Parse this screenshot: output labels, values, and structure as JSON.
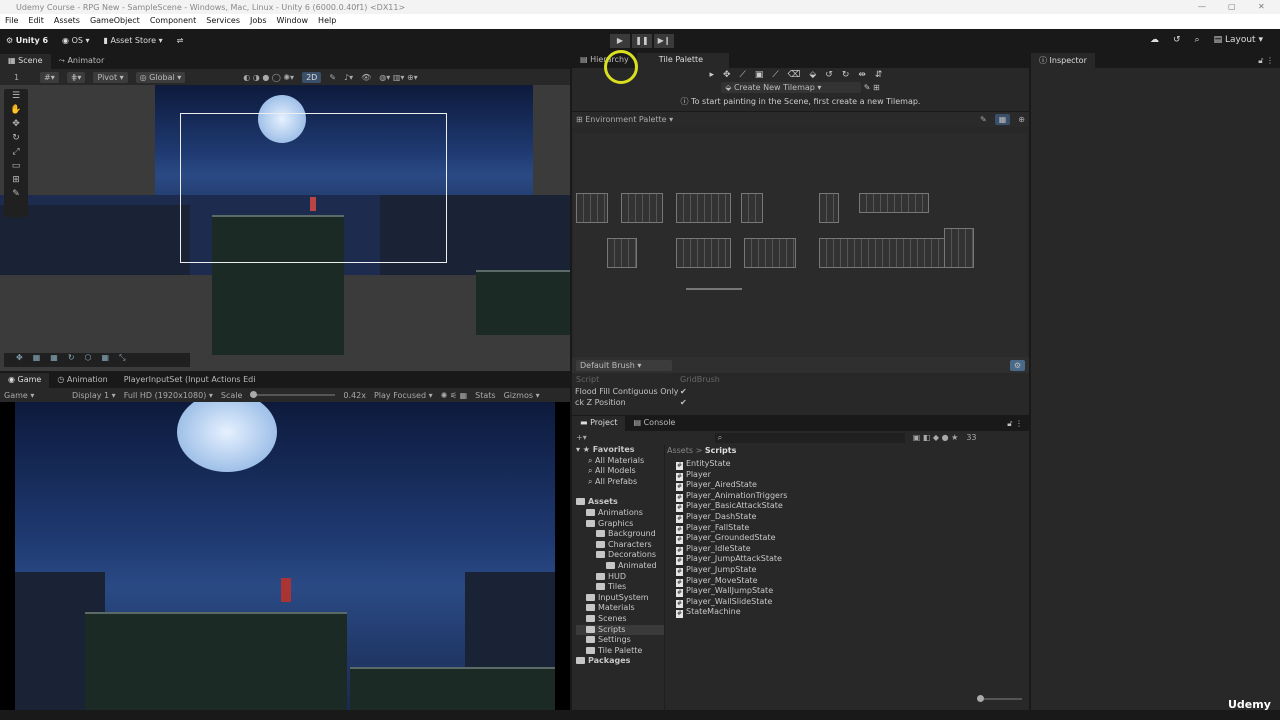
{
  "window": {
    "title": "Udemy Course - RPG New - SampleScene - Windows, Mac, Linux - Unity 6 (6000.0.40f1) <DX11>"
  },
  "menu": [
    "File",
    "Edit",
    "Assets",
    "GameObject",
    "Component",
    "Services",
    "Jobs",
    "Window",
    "Help"
  ],
  "toolbar": {
    "unity": "Unity 6",
    "account": "OS",
    "asset_store": "Asset Store",
    "layout": "Layout"
  },
  "scene": {
    "tabs": [
      "Scene",
      "Animator"
    ],
    "layer": "1",
    "pivot": "Pivot",
    "global": "Global",
    "mode2d": "2D"
  },
  "game": {
    "tabs": [
      "Game",
      "Animation",
      "PlayerInputSet (Input Actions Edi"
    ],
    "view": "Game",
    "display": "Display 1",
    "resolution": "Full HD (1920x1080)",
    "scale_label": "Scale",
    "scale_value": "0.42x",
    "play_mode": "Play Focused",
    "stats": "Stats",
    "gizmos": "Gizmos"
  },
  "tilepalette": {
    "tabs": [
      "Hierarchy",
      "Tile Palette"
    ],
    "target": "Create New Tilemap",
    "info": "To start painting in the Scene, first create a new Tilemap.",
    "palette": "Environment Palette",
    "brush": "Default Brush",
    "script_label": "Script",
    "script_value": "GridBrush",
    "flood_fill": "Flood Fill Contiguous Only",
    "lock_z": "ck Z Position"
  },
  "project": {
    "tabs": [
      "Project",
      "Console"
    ],
    "count": "33",
    "breadcrumb": [
      "Assets",
      "Scripts"
    ],
    "favorites": {
      "label": "Favorites",
      "items": [
        "All Materials",
        "All Models",
        "All Prefabs"
      ]
    },
    "tree": [
      {
        "label": "Assets",
        "level": 0
      },
      {
        "label": "Animations",
        "level": 1
      },
      {
        "label": "Graphics",
        "level": 1
      },
      {
        "label": "Background",
        "level": 2
      },
      {
        "label": "Characters",
        "level": 2
      },
      {
        "label": "Decorations",
        "level": 2
      },
      {
        "label": "Animated",
        "level": 3
      },
      {
        "label": "HUD",
        "level": 2
      },
      {
        "label": "Tiles",
        "level": 2
      },
      {
        "label": "InputSystem",
        "level": 1
      },
      {
        "label": "Materials",
        "level": 1
      },
      {
        "label": "Scenes",
        "level": 1
      },
      {
        "label": "Scripts",
        "level": 1
      },
      {
        "label": "Settings",
        "level": 1
      },
      {
        "label": "Tile Palette",
        "level": 1
      },
      {
        "label": "Packages",
        "level": 0
      }
    ],
    "files": [
      "EntityState",
      "Player",
      "Player_AiredState",
      "Player_AnimationTriggers",
      "Player_BasicAttackState",
      "Player_DashState",
      "Player_FallState",
      "Player_GroundedState",
      "Player_IdleState",
      "Player_JumpAttackState",
      "Player_JumpState",
      "Player_MoveState",
      "Player_WallJumpState",
      "Player_WallSlideState",
      "StateMachine"
    ]
  },
  "inspector": {
    "tab": "Inspector"
  },
  "watermark": "Udemy"
}
